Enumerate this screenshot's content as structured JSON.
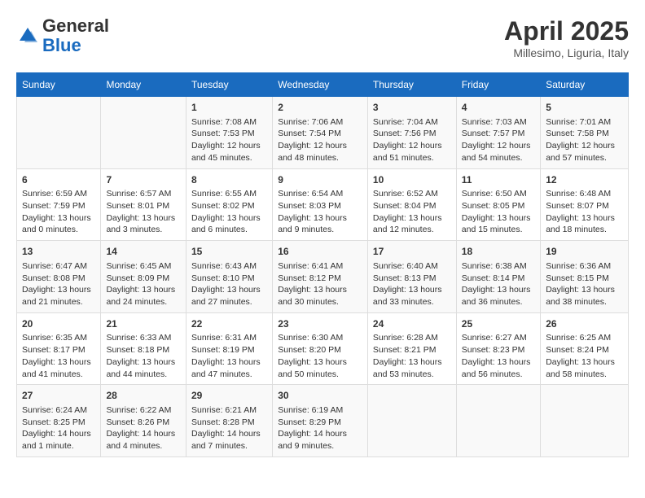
{
  "header": {
    "logo_general": "General",
    "logo_blue": "Blue",
    "main_title": "April 2025",
    "subtitle": "Millesimo, Liguria, Italy"
  },
  "days_of_week": [
    "Sunday",
    "Monday",
    "Tuesday",
    "Wednesday",
    "Thursday",
    "Friday",
    "Saturday"
  ],
  "weeks": [
    [
      {
        "day": "",
        "content": ""
      },
      {
        "day": "",
        "content": ""
      },
      {
        "day": "1",
        "content": "Sunrise: 7:08 AM\nSunset: 7:53 PM\nDaylight: 12 hours and 45 minutes."
      },
      {
        "day": "2",
        "content": "Sunrise: 7:06 AM\nSunset: 7:54 PM\nDaylight: 12 hours and 48 minutes."
      },
      {
        "day": "3",
        "content": "Sunrise: 7:04 AM\nSunset: 7:56 PM\nDaylight: 12 hours and 51 minutes."
      },
      {
        "day": "4",
        "content": "Sunrise: 7:03 AM\nSunset: 7:57 PM\nDaylight: 12 hours and 54 minutes."
      },
      {
        "day": "5",
        "content": "Sunrise: 7:01 AM\nSunset: 7:58 PM\nDaylight: 12 hours and 57 minutes."
      }
    ],
    [
      {
        "day": "6",
        "content": "Sunrise: 6:59 AM\nSunset: 7:59 PM\nDaylight: 13 hours and 0 minutes."
      },
      {
        "day": "7",
        "content": "Sunrise: 6:57 AM\nSunset: 8:01 PM\nDaylight: 13 hours and 3 minutes."
      },
      {
        "day": "8",
        "content": "Sunrise: 6:55 AM\nSunset: 8:02 PM\nDaylight: 13 hours and 6 minutes."
      },
      {
        "day": "9",
        "content": "Sunrise: 6:54 AM\nSunset: 8:03 PM\nDaylight: 13 hours and 9 minutes."
      },
      {
        "day": "10",
        "content": "Sunrise: 6:52 AM\nSunset: 8:04 PM\nDaylight: 13 hours and 12 minutes."
      },
      {
        "day": "11",
        "content": "Sunrise: 6:50 AM\nSunset: 8:05 PM\nDaylight: 13 hours and 15 minutes."
      },
      {
        "day": "12",
        "content": "Sunrise: 6:48 AM\nSunset: 8:07 PM\nDaylight: 13 hours and 18 minutes."
      }
    ],
    [
      {
        "day": "13",
        "content": "Sunrise: 6:47 AM\nSunset: 8:08 PM\nDaylight: 13 hours and 21 minutes."
      },
      {
        "day": "14",
        "content": "Sunrise: 6:45 AM\nSunset: 8:09 PM\nDaylight: 13 hours and 24 minutes."
      },
      {
        "day": "15",
        "content": "Sunrise: 6:43 AM\nSunset: 8:10 PM\nDaylight: 13 hours and 27 minutes."
      },
      {
        "day": "16",
        "content": "Sunrise: 6:41 AM\nSunset: 8:12 PM\nDaylight: 13 hours and 30 minutes."
      },
      {
        "day": "17",
        "content": "Sunrise: 6:40 AM\nSunset: 8:13 PM\nDaylight: 13 hours and 33 minutes."
      },
      {
        "day": "18",
        "content": "Sunrise: 6:38 AM\nSunset: 8:14 PM\nDaylight: 13 hours and 36 minutes."
      },
      {
        "day": "19",
        "content": "Sunrise: 6:36 AM\nSunset: 8:15 PM\nDaylight: 13 hours and 38 minutes."
      }
    ],
    [
      {
        "day": "20",
        "content": "Sunrise: 6:35 AM\nSunset: 8:17 PM\nDaylight: 13 hours and 41 minutes."
      },
      {
        "day": "21",
        "content": "Sunrise: 6:33 AM\nSunset: 8:18 PM\nDaylight: 13 hours and 44 minutes."
      },
      {
        "day": "22",
        "content": "Sunrise: 6:31 AM\nSunset: 8:19 PM\nDaylight: 13 hours and 47 minutes."
      },
      {
        "day": "23",
        "content": "Sunrise: 6:30 AM\nSunset: 8:20 PM\nDaylight: 13 hours and 50 minutes."
      },
      {
        "day": "24",
        "content": "Sunrise: 6:28 AM\nSunset: 8:21 PM\nDaylight: 13 hours and 53 minutes."
      },
      {
        "day": "25",
        "content": "Sunrise: 6:27 AM\nSunset: 8:23 PM\nDaylight: 13 hours and 56 minutes."
      },
      {
        "day": "26",
        "content": "Sunrise: 6:25 AM\nSunset: 8:24 PM\nDaylight: 13 hours and 58 minutes."
      }
    ],
    [
      {
        "day": "27",
        "content": "Sunrise: 6:24 AM\nSunset: 8:25 PM\nDaylight: 14 hours and 1 minute."
      },
      {
        "day": "28",
        "content": "Sunrise: 6:22 AM\nSunset: 8:26 PM\nDaylight: 14 hours and 4 minutes."
      },
      {
        "day": "29",
        "content": "Sunrise: 6:21 AM\nSunset: 8:28 PM\nDaylight: 14 hours and 7 minutes."
      },
      {
        "day": "30",
        "content": "Sunrise: 6:19 AM\nSunset: 8:29 PM\nDaylight: 14 hours and 9 minutes."
      },
      {
        "day": "",
        "content": ""
      },
      {
        "day": "",
        "content": ""
      },
      {
        "day": "",
        "content": ""
      }
    ]
  ]
}
